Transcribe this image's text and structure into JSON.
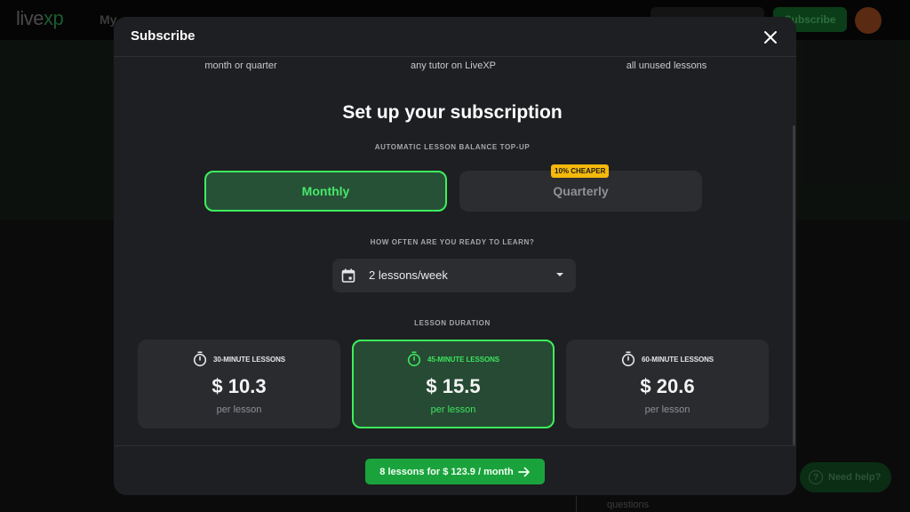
{
  "background": {
    "logo": {
      "text_live": "live",
      "text_xp": "xp"
    },
    "nav_partial": "My",
    "subscribe_button": "Subscribe",
    "questions_text": "questions",
    "need_help": {
      "icon": "question-circle-icon",
      "label": "Need help?"
    }
  },
  "modal": {
    "title": "Subscribe",
    "close_icon": "close-icon",
    "benefits": [
      {
        "text": "month or quarter"
      },
      {
        "text": "any tutor on LiveXP"
      },
      {
        "text": "all unused lessons"
      }
    ],
    "heading": "Set up your subscription",
    "topup_label": "AUTOMATIC LESSON BALANCE TOP-UP",
    "periods": [
      {
        "label": "Monthly",
        "selected": true
      },
      {
        "label": "Quarterly",
        "selected": false,
        "badge": "10% CHEAPER"
      }
    ],
    "frequency": {
      "label": "HOW OFTEN ARE YOU READY TO LEARN?",
      "icon": "calendar-icon",
      "value": "2 lessons/week"
    },
    "duration": {
      "label": "LESSON DURATION",
      "options": [
        {
          "name": "30-MINUTE LESSONS",
          "price": "$ 10.3",
          "unit": "per lesson",
          "icon": "stopwatch-icon",
          "selected": false
        },
        {
          "name": "45-MINUTE LESSONS",
          "price": "$ 15.5",
          "unit": "per lesson",
          "icon": "stopwatch-icon",
          "selected": true
        },
        {
          "name": "60-MINUTE LESSONS",
          "price": "$ 20.6",
          "unit": "per lesson",
          "icon": "stopwatch-icon",
          "selected": false
        }
      ]
    },
    "cta": {
      "label": "8 lessons for $ 123.9 / month",
      "icon": "arrow-right-icon"
    }
  },
  "colors": {
    "accent_green": "#3cf15c",
    "cta_green": "#1aa33c",
    "badge_yellow": "#f5b90b",
    "modal_bg": "#1e1f22"
  }
}
